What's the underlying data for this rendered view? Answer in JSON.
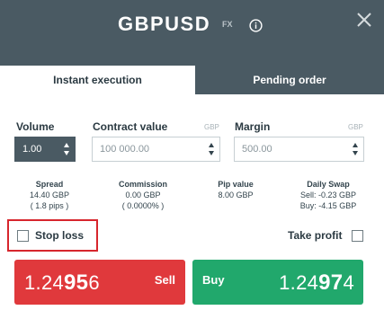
{
  "header": {
    "symbol": "GBPUSD",
    "badge": "FX",
    "info_icon": "info-icon",
    "close_icon": "close-icon"
  },
  "tabs": [
    {
      "label": "Instant execution",
      "active": true
    },
    {
      "label": "Pending order",
      "active": false
    }
  ],
  "fields": {
    "volume": {
      "label": "Volume",
      "value": "1.00"
    },
    "contract_value": {
      "label": "Contract value",
      "unit": "GBP",
      "value": "100 000.00"
    },
    "margin": {
      "label": "Margin",
      "unit": "GBP",
      "value": "500.00"
    }
  },
  "stats": {
    "spread": {
      "label": "Spread",
      "line1": "14.40 GBP",
      "line2": "( 1.8 pips )"
    },
    "commission": {
      "label": "Commission",
      "line1": "0.00 GBP",
      "line2": "( 0.0000% )"
    },
    "pip_value": {
      "label": "Pip value",
      "line1": "8.00 GBP"
    },
    "daily_swap": {
      "label": "Daily Swap",
      "line1": "Sell: -0.23 GBP",
      "line2": "Buy: -4.15 GBP"
    }
  },
  "stop_loss": {
    "label": "Stop loss",
    "checked": false
  },
  "take_profit": {
    "label": "Take profit",
    "checked": false
  },
  "sell": {
    "label": "Sell",
    "price_prefix": "1.24",
    "price_big": "95",
    "price_suffix": "6"
  },
  "buy": {
    "label": "Buy",
    "price_prefix": "1.24",
    "price_big": "97",
    "price_suffix": "4"
  },
  "colors": {
    "header_bg": "#4a5a63",
    "sell": "#e0393c",
    "buy": "#21a86c",
    "highlight": "#d7262d"
  }
}
